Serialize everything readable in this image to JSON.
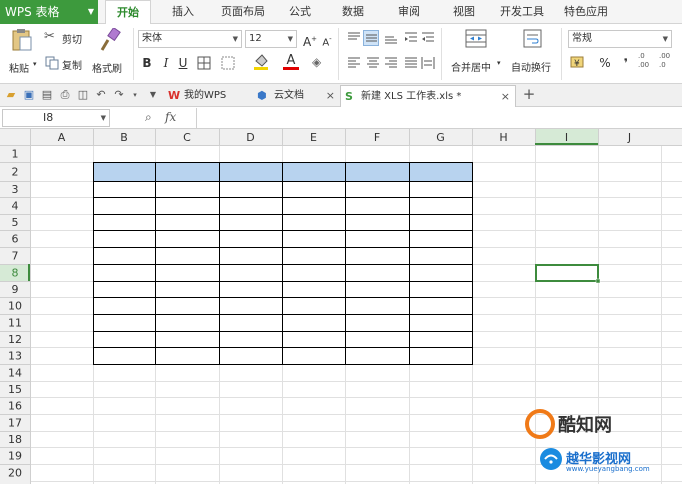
{
  "app": {
    "name": "WPS 表格"
  },
  "menu_tabs": [
    "开始",
    "插入",
    "页面布局",
    "公式",
    "数据",
    "审阅",
    "视图",
    "开发工具",
    "特色应用"
  ],
  "ribbon": {
    "paste_label": "粘贴",
    "cut_label": "剪切",
    "copy_label": "复制",
    "format_painter_label": "格式刷",
    "font_name": "宋体",
    "font_size": "12",
    "bold": "B",
    "italic": "I",
    "underline": "U",
    "merge_center_label": "合并居中",
    "wrap_text_label": "自动换行",
    "number_format": "常规",
    "percent": "%",
    "comma": "❜"
  },
  "doc_tabs": [
    {
      "label": "我的WPS"
    },
    {
      "label": "云文档"
    },
    {
      "label": "新建 XLS 工作表.xls *"
    }
  ],
  "formula_bar": {
    "cell_ref": "I8",
    "fx": "fx",
    "formula_value": ""
  },
  "sheet": {
    "columns": [
      "A",
      "B",
      "C",
      "D",
      "E",
      "F",
      "G",
      "H",
      "I",
      "J"
    ],
    "rows": [
      "1",
      "2",
      "3",
      "4",
      "5",
      "6",
      "7",
      "8",
      "9",
      "10",
      "11",
      "12",
      "13",
      "14",
      "15",
      "16",
      "17",
      "18",
      "19",
      "20"
    ],
    "selected_cell": {
      "col": "I",
      "row": "8"
    },
    "table_header_fill": "#b8d3ef",
    "table_range": {
      "cols": [
        "B",
        "C",
        "D",
        "E",
        "F",
        "G"
      ],
      "header_row": "2",
      "body_rows": [
        "3",
        "4",
        "5",
        "6",
        "7",
        "8",
        "9",
        "10",
        "11",
        "12",
        "13"
      ]
    }
  },
  "colors": {
    "brand_green": "#3d9a3d",
    "active_tab_text": "#2d8a2d",
    "selection_border": "#3d8b3d",
    "header_bg": "#f0f0f0",
    "gridline": "#e0e0e0"
  },
  "watermark": {
    "line1": "酷知网",
    "line2": "越华影视网",
    "line3": "www.yueyangbang.com"
  }
}
